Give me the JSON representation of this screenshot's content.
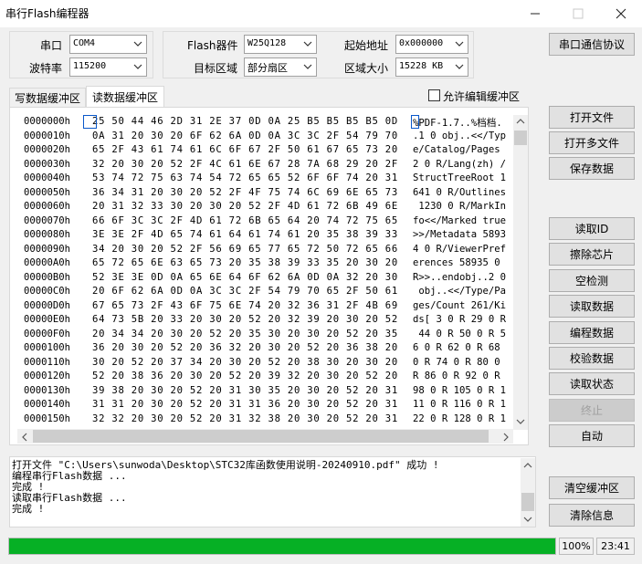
{
  "window": {
    "title": "串行Flash编程器"
  },
  "port_group": {
    "port_label": "串口",
    "port_value": "COM4",
    "baud_label": "波特率",
    "baud_value": "115200"
  },
  "flash_group": {
    "device_label": "Flash器件",
    "device_value": "W25Q128",
    "start_label": "起始地址",
    "start_value": "0x000000",
    "area_label": "目标区域",
    "area_value": "部分扇区",
    "size_label": "区域大小",
    "size_value": "15228 KB"
  },
  "protocol_button": "串口通信协议",
  "tabs": [
    {
      "label": "写数据缓冲区",
      "active": false
    },
    {
      "label": "读数据缓冲区",
      "active": true
    }
  ],
  "allow_edit_label": "允许编辑缓冲区",
  "allow_edit_checked": false,
  "hex_rows": [
    {
      "addr": "0000000h",
      "hex": "25 50 44 46 2D 31 2E 37 0D 0A 25 B5 B5 B5 B5 0D",
      "ascii": "%PDF-1.7..%档档."
    },
    {
      "addr": "0000010h",
      "hex": "0A 31 20 30 20 6F 62 6A 0D 0A 3C 3C 2F 54 79 70",
      "ascii": ".1 0 obj..<</Typ"
    },
    {
      "addr": "0000020h",
      "hex": "65 2F 43 61 74 61 6C 6F 67 2F 50 61 67 65 73 20",
      "ascii": "e/Catalog/Pages "
    },
    {
      "addr": "0000030h",
      "hex": "32 20 30 20 52 2F 4C 61 6E 67 28 7A 68 29 20 2F",
      "ascii": "2 0 R/Lang(zh) /"
    },
    {
      "addr": "0000040h",
      "hex": "53 74 72 75 63 74 54 72 65 65 52 6F 6F 74 20 31",
      "ascii": "StructTreeRoot 1"
    },
    {
      "addr": "0000050h",
      "hex": "36 34 31 20 30 20 52 2F 4F 75 74 6C 69 6E 65 73",
      "ascii": "641 0 R/Outlines"
    },
    {
      "addr": "0000060h",
      "hex": "20 31 32 33 30 20 30 20 52 2F 4D 61 72 6B 49 6E",
      "ascii": " 1230 0 R/MarkIn"
    },
    {
      "addr": "0000070h",
      "hex": "66 6F 3C 3C 2F 4D 61 72 6B 65 64 20 74 72 75 65",
      "ascii": "fo<</Marked true"
    },
    {
      "addr": "0000080h",
      "hex": "3E 3E 2F 4D 65 74 61 64 61 74 61 20 35 38 39 33",
      "ascii": ">>/Metadata 5893"
    },
    {
      "addr": "0000090h",
      "hex": "34 20 30 20 52 2F 56 69 65 77 65 72 50 72 65 66",
      "ascii": "4 0 R/ViewerPref"
    },
    {
      "addr": "00000A0h",
      "hex": "65 72 65 6E 63 65 73 20 35 38 39 33 35 20 30 20",
      "ascii": "erences 58935 0 "
    },
    {
      "addr": "00000B0h",
      "hex": "52 3E 3E 0D 0A 65 6E 64 6F 62 6A 0D 0A 32 20 30",
      "ascii": "R>>..endobj..2 0"
    },
    {
      "addr": "00000C0h",
      "hex": "20 6F 62 6A 0D 0A 3C 3C 2F 54 79 70 65 2F 50 61",
      "ascii": " obj..<</Type/Pa"
    },
    {
      "addr": "00000D0h",
      "hex": "67 65 73 2F 43 6F 75 6E 74 20 32 36 31 2F 4B 69",
      "ascii": "ges/Count 261/Ki"
    },
    {
      "addr": "00000E0h",
      "hex": "64 73 5B 20 33 20 30 20 52 20 32 39 20 30 20 52",
      "ascii": "ds[ 3 0 R 29 0 R"
    },
    {
      "addr": "00000F0h",
      "hex": "20 34 34 20 30 20 52 20 35 30 20 30 20 52 20 35",
      "ascii": " 44 0 R 50 0 R 5"
    },
    {
      "addr": "0000100h",
      "hex": "36 20 30 20 52 20 36 32 20 30 20 52 20 36 38 20",
      "ascii": "6 0 R 62 0 R 68 "
    },
    {
      "addr": "0000110h",
      "hex": "30 20 52 20 37 34 20 30 20 52 20 38 30 20 30 20",
      "ascii": "0 R 74 0 R 80 0 "
    },
    {
      "addr": "0000120h",
      "hex": "52 20 38 36 20 30 20 52 20 39 32 20 30 20 52 20",
      "ascii": "R 86 0 R 92 0 R "
    },
    {
      "addr": "0000130h",
      "hex": "39 38 20 30 20 52 20 31 30 35 20 30 20 52 20 31",
      "ascii": "98 0 R 105 0 R 1"
    },
    {
      "addr": "0000140h",
      "hex": "31 31 20 30 20 52 20 31 31 36 20 30 20 52 20 31",
      "ascii": "11 0 R 116 0 R 1"
    },
    {
      "addr": "0000150h",
      "hex": "32 32 20 30 20 52 20 31 32 38 20 30 20 52 20 31",
      "ascii": "22 0 R 128 0 R 1"
    }
  ],
  "right_buttons": {
    "open_file": "打开文件",
    "open_multi": "打开多文件",
    "save_data": "保存数据",
    "read_id": "读取ID",
    "erase_chip": "擦除芯片",
    "blank_check": "空检测",
    "read_data": "读取数据",
    "program_data": "编程数据",
    "verify_data": "校验数据",
    "read_status": "读取状态",
    "stop": "终止",
    "auto": "自动",
    "clear_buffer": "清空缓冲区",
    "clear_info": "清除信息"
  },
  "log_lines": [
    "打开文件 \"C:\\Users\\sunwoda\\Desktop\\STC32库函数使用说明-20240910.pdf\" 成功 !",
    "编程串行Flash数据 ...",
    "完成 !",
    "读取串行Flash数据 ...",
    "完成 !"
  ],
  "status": {
    "progress_percent": 100,
    "progress_label": "100%",
    "time": "23:41"
  },
  "colors": {
    "progress_green": "#06b025",
    "selection_blue": "#0a58ca"
  }
}
